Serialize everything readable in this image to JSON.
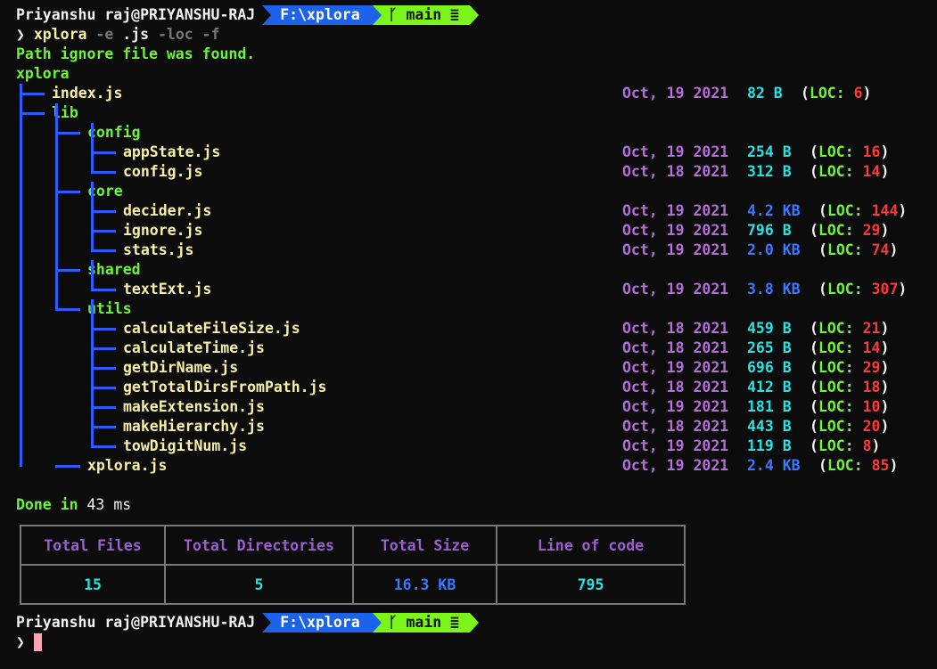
{
  "prompt": {
    "user_host": "Priyanshu raj@PRIYANSHU-RAJ",
    "path": "F:\\xplora",
    "branch_icon": "git-branch-icon",
    "branch": "main",
    "branch_status": "≣",
    "symbol": "❯"
  },
  "command": {
    "program": "xplora",
    "flag_e": "-e",
    "ext": ".js",
    "flag_loc": "-loc",
    "flag_f": "-f"
  },
  "messages": {
    "ignore_found": "Path ignore file was found.",
    "done_prefix": "Done",
    "done_in": "in",
    "done_value": "43",
    "done_unit": "ms"
  },
  "tree": {
    "root": "xplora",
    "loc_label": "LOC:",
    "rows": [
      {
        "name": "index.js",
        "type": "file",
        "date": "Oct, 19 2021",
        "size": "82 B",
        "loc": "6"
      },
      {
        "name": "lib",
        "type": "dir"
      },
      {
        "name": "config",
        "type": "dir"
      },
      {
        "name": "appState.js",
        "type": "file",
        "date": "Oct, 19 2021",
        "size": "254 B",
        "loc": "16"
      },
      {
        "name": "config.js",
        "type": "file",
        "date": "Oct, 18 2021",
        "size": "312 B",
        "loc": "14"
      },
      {
        "name": "core",
        "type": "dir"
      },
      {
        "name": "decider.js",
        "type": "file",
        "date": "Oct, 19 2021",
        "size": "4.2 KB",
        "loc": "144"
      },
      {
        "name": "ignore.js",
        "type": "file",
        "date": "Oct, 19 2021",
        "size": "796 B",
        "loc": "29"
      },
      {
        "name": "stats.js",
        "type": "file",
        "date": "Oct, 19 2021",
        "size": "2.0 KB",
        "loc": "74"
      },
      {
        "name": "shared",
        "type": "dir"
      },
      {
        "name": "textExt.js",
        "type": "file",
        "date": "Oct, 19 2021",
        "size": "3.8 KB",
        "loc": "307"
      },
      {
        "name": "utils",
        "type": "dir"
      },
      {
        "name": "calculateFileSize.js",
        "type": "file",
        "date": "Oct, 18 2021",
        "size": "459 B",
        "loc": "21"
      },
      {
        "name": "calculateTime.js",
        "type": "file",
        "date": "Oct, 18 2021",
        "size": "265 B",
        "loc": "14"
      },
      {
        "name": "getDirName.js",
        "type": "file",
        "date": "Oct, 19 2021",
        "size": "696 B",
        "loc": "29"
      },
      {
        "name": "getTotalDirsFromPath.js",
        "type": "file",
        "date": "Oct, 18 2021",
        "size": "412 B",
        "loc": "18"
      },
      {
        "name": "makeExtension.js",
        "type": "file",
        "date": "Oct, 19 2021",
        "size": "181 B",
        "loc": "10"
      },
      {
        "name": "makeHierarchy.js",
        "type": "file",
        "date": "Oct, 18 2021",
        "size": "443 B",
        "loc": "20"
      },
      {
        "name": "towDigitNum.js",
        "type": "file",
        "date": "Oct, 19 2021",
        "size": "119 B",
        "loc": "8"
      },
      {
        "name": "xplora.js",
        "type": "file",
        "date": "Oct, 19 2021",
        "size": "2.4 KB",
        "loc": "85"
      }
    ]
  },
  "summary": {
    "headers": [
      "Total Files",
      "Total Directories",
      "Total Size",
      "Line of code"
    ],
    "values": [
      "15",
      "5",
      "16.3 KB",
      "795"
    ]
  },
  "colors": {
    "background": "#0c0c0c",
    "path_segment": "#1d63e9",
    "git_segment": "#7cf51a",
    "date": "#b46ed8",
    "size_bytes": "#2de0e0",
    "size_kb": "#3b78ff",
    "loc_number": "#ff3838",
    "tree_lines": "#2a5cff",
    "cursor": "#f7a6b4"
  }
}
